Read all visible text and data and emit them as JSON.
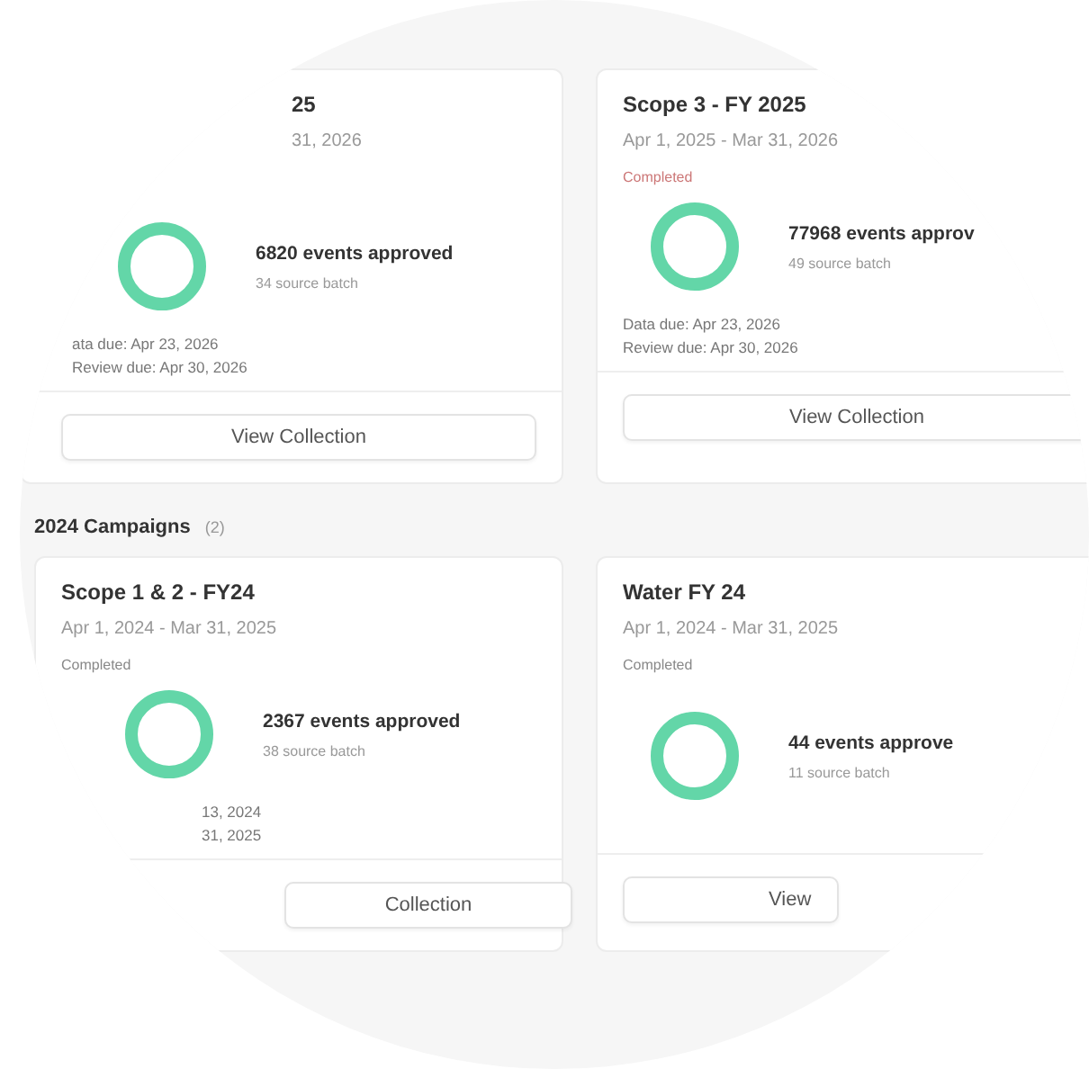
{
  "sections": [
    {
      "cards": [
        {
          "title": "25",
          "dates": "31, 2026",
          "events": "6820 events approved",
          "batches": "34 source batch",
          "due": [
            "ata due: Apr 23, 2026",
            "Review due: Apr 30, 2026"
          ],
          "button": "View Collection"
        },
        {
          "title": "Scope 3 - FY 2025",
          "dates": "Apr 1, 2025 - Mar 31, 2026",
          "status": "Completed",
          "events": "77968 events approv",
          "batches": "49 source batch",
          "due": [
            "Data due: Apr 23, 2026",
            "Review due: Apr 30, 2026"
          ],
          "button": "View Collection"
        }
      ]
    },
    {
      "title": "2024 Campaigns",
      "count": "(2)",
      "cards": [
        {
          "title": "Scope 1 & 2 - FY24",
          "dates": "Apr 1, 2024 - Mar 31, 2025",
          "status": "Completed",
          "events": "2367 events approved",
          "batches": "38 source batch",
          "due": [
            "13, 2024",
            "31, 2025"
          ],
          "button": "Collection"
        },
        {
          "title": "Water FY 24",
          "dates": "Apr 1, 2024 - Mar 31, 2025",
          "status": "Completed",
          "events": "44 events approve",
          "batches": "11 source batch",
          "button": "View"
        }
      ]
    }
  ]
}
